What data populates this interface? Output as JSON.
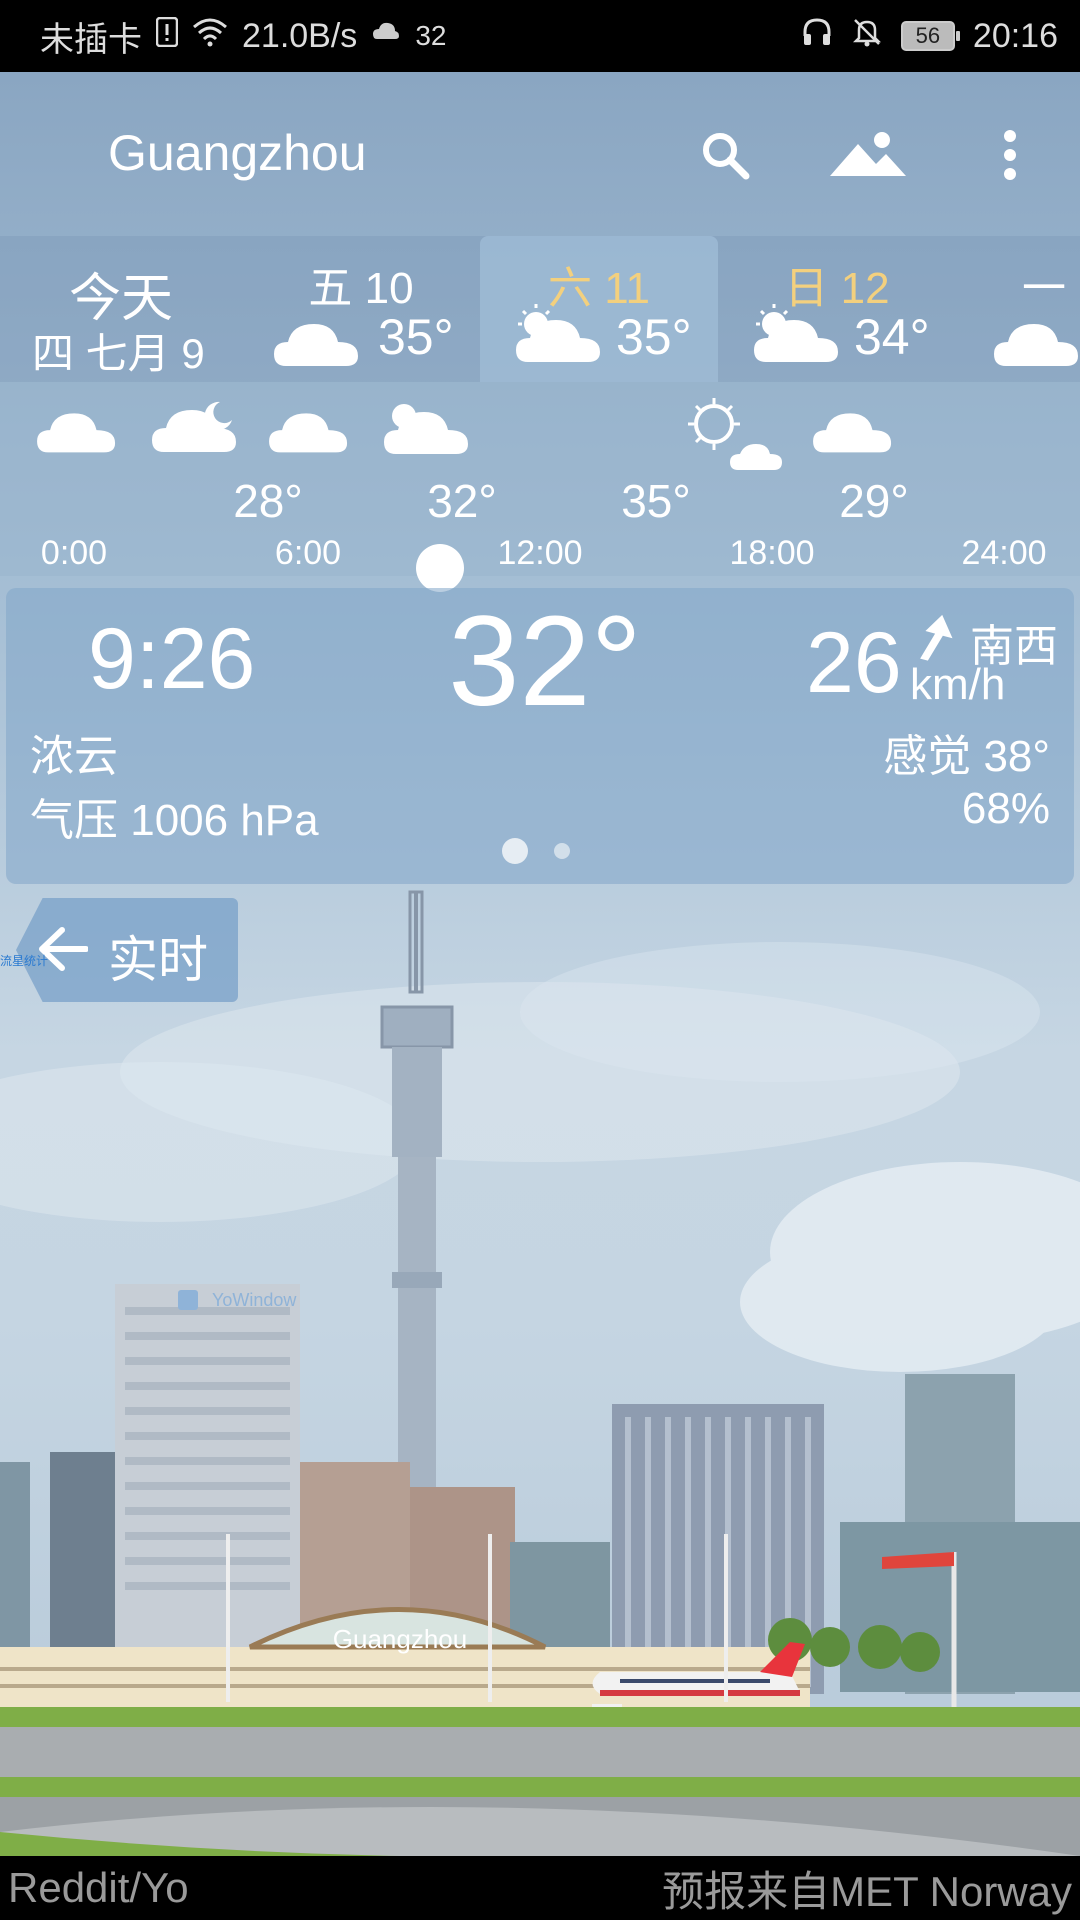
{
  "status_bar": {
    "carrier": "未插卡",
    "speed": "21.0B/s",
    "temp_small": "32",
    "battery": "56",
    "time": "20:16"
  },
  "header": {
    "city": "Guangzhou",
    "search_icon": "search-icon",
    "landscape_icon": "landscape-icon",
    "menu_icon": "more-vert-icon"
  },
  "days": [
    {
      "top": "今天",
      "sub": "四 七月 9",
      "temp": ""
    },
    {
      "top": "五 10",
      "sub": "",
      "temp": "35°"
    },
    {
      "top": "六 11",
      "sub": "",
      "temp": "35°"
    },
    {
      "top": "日 12",
      "sub": "",
      "temp": "34°"
    },
    {
      "top": "一",
      "sub": "",
      "temp": ""
    }
  ],
  "hourly": {
    "temps": [
      "28°",
      "32°",
      "35°",
      "29°"
    ],
    "times": [
      "0:00",
      "6:00",
      "12:00",
      "18:00",
      "24:00"
    ]
  },
  "current": {
    "time": "9:26",
    "temp": "32°",
    "wind_speed": "26",
    "wind_unit": "km/h",
    "wind_dir": "南西",
    "condition": "浓云",
    "feels_like": "感觉 38°",
    "pressure": "气压 1006 hPa",
    "humidity": "68%"
  },
  "live": {
    "label": "实时",
    "tiny_text": "流星统计"
  },
  "scene": {
    "watermark": "YoWindow",
    "terminal_sign": "Guangzhou"
  },
  "footer": {
    "left": "Reddit/Yo",
    "right": "预报来自MET Norway"
  },
  "colors": {
    "weekend": "#f3d07e",
    "sky_top": "#8aa6c2",
    "sky_mid": "#c6d6e3",
    "panel": "#82a5c8"
  }
}
